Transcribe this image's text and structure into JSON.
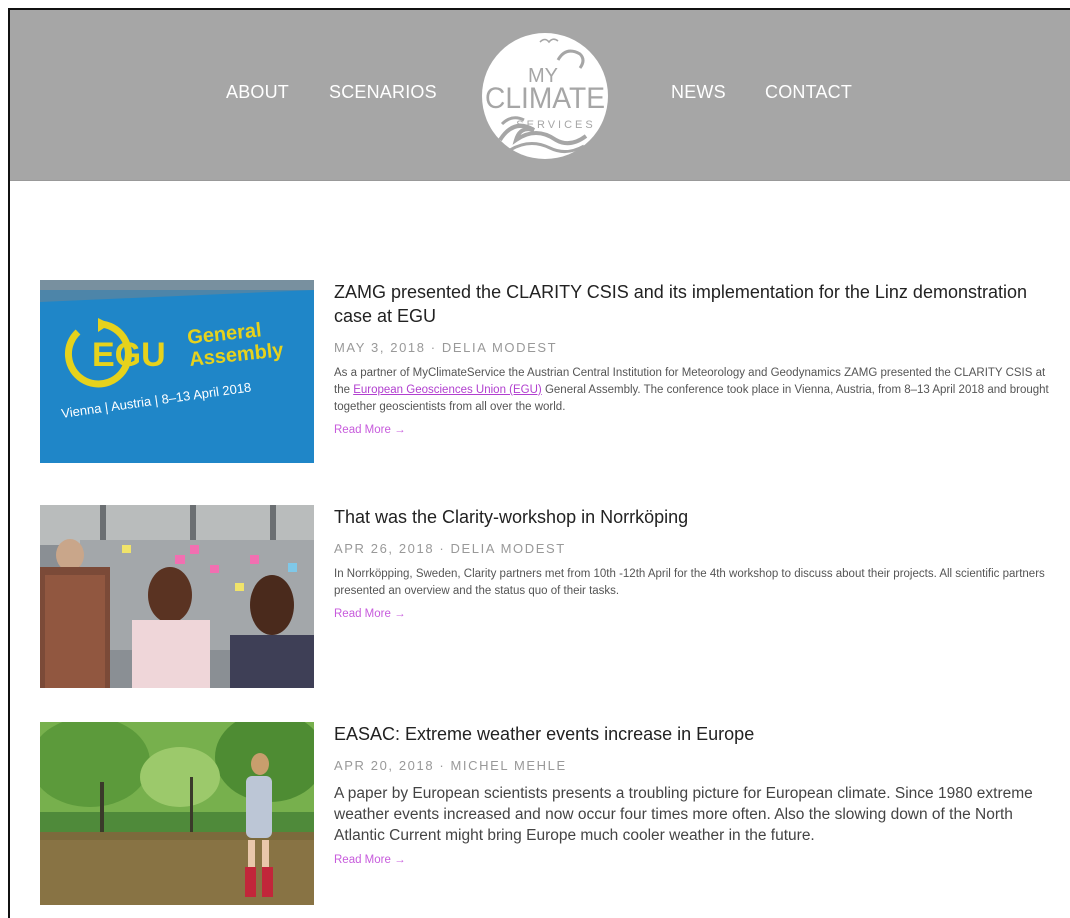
{
  "nav": {
    "about": "ABOUT",
    "scenarios": "SCENARIOS",
    "news": "NEWS",
    "contact": "CONTACT"
  },
  "logo": {
    "line1": "MY",
    "line2": "CLIMATE",
    "line3": "SERVICES"
  },
  "colors": {
    "header_bg": "#a6a6a6",
    "link_accent": "#c75bdc",
    "egu_blue": "#1f86c8",
    "egu_yellow": "#e6d21c"
  },
  "posts": [
    {
      "title": "ZAMG presented the CLARITY CSIS and its implementation for the Linz demonstration case at EGU",
      "meta": "MAY 3, 2018  ·  DELIA MODEST",
      "excerpt_before": "As a partner of MyClimateService the Austrian Central Institution for Meteorology and Geodynamics ZAMG presented the CLARITY CSIS at the ",
      "excerpt_link": "European Geosciences Union (EGU)",
      "excerpt_after": " General Assembly. The conference took place in Vienna, Austria, from 8–13 April 2018 and brought together geoscientists from all over the world.",
      "read_more": "Read More →",
      "image": {
        "egu": "EGU",
        "general": "General",
        "assembly": "Assembly",
        "subtitle": "Vienna | Austria | 8–13 April 2018"
      }
    },
    {
      "title": "That was the Clarity-workshop in Norrköping",
      "meta": "APR 26, 2018  ·  DELIA MODEST",
      "excerpt": "In Norrköpping, Sweden, Clarity partners met from 10th -12th April for the 4th workshop to discuss about their projects. All scientific partners presented an overview and the status quo of their tasks.",
      "read_more": "Read More →"
    },
    {
      "title": "EASAC: Extreme weather events increase in Europe",
      "meta": "APR 20, 2018  ·  MICHEL MEHLE",
      "excerpt": "A paper by European scientists presents a troubling picture for European climate. Since 1980 extreme weather events increased and now occur four times more often. Also the slowing down of the North Atlantic Current might bring Europe much cooler weather in the future.",
      "read_more": "Read More →"
    }
  ]
}
